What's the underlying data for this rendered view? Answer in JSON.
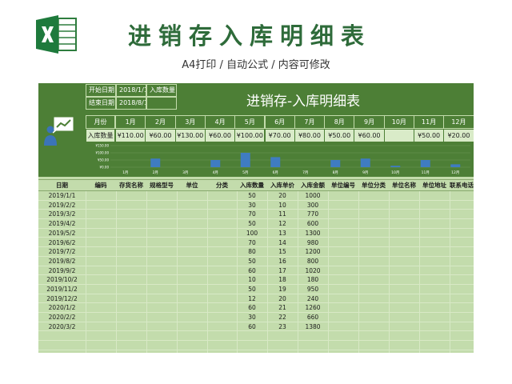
{
  "header": {
    "title": "进销存入库明细表",
    "subtitle": "A4打印 / 自动公式 / 内容可修改"
  },
  "sheet": {
    "title": "进销存-入库明细表",
    "info": {
      "start_label": "开始日期",
      "start_value": "2018/1/1",
      "end_label": "结束日期",
      "end_value": "2018/8/1",
      "qty_label": "入库数量"
    },
    "month_row_label": "月份",
    "amount_row_label": "入库数量",
    "months": [
      "1月",
      "2月",
      "3月",
      "4月",
      "5月",
      "6月",
      "7月",
      "8月",
      "9月",
      "10月",
      "11月",
      "12月"
    ],
    "amounts": [
      "¥110.00",
      "¥60.00",
      "¥130.00",
      "¥60.00",
      "¥100.00",
      "¥70.00",
      "¥80.00",
      "¥50.00",
      "¥60.00",
      "",
      "¥50.00",
      "¥20.00"
    ]
  },
  "chart_data": {
    "type": "bar",
    "categories": [
      "1月",
      "2月",
      "3月",
      "4月",
      "5月",
      "6月",
      "7月",
      "8月",
      "9月",
      "10月",
      "11月",
      "12月"
    ],
    "values": [
      0,
      60,
      0,
      50,
      100,
      70,
      0,
      50,
      60,
      10,
      50,
      20
    ],
    "ytick_labels": [
      "¥150.00",
      "¥100.00",
      "¥50.00",
      "¥0.00"
    ],
    "yticks": [
      150,
      100,
      50,
      0
    ],
    "ylim": [
      0,
      150
    ],
    "bar_color": "#3f7cc1"
  },
  "table": {
    "columns": [
      "日期",
      "编码",
      "存货名称",
      "规格型号",
      "单位",
      "分类",
      "入库数量",
      "入库单价",
      "入库金额",
      "单位编号",
      "单位分类",
      "单位名称",
      "单位地址",
      "联系电话"
    ],
    "rows": [
      {
        "date": "2019/1/1",
        "qty": "50",
        "price": "20",
        "amount": "1000"
      },
      {
        "date": "2019/2/2",
        "qty": "30",
        "price": "10",
        "amount": "300"
      },
      {
        "date": "2019/3/2",
        "qty": "70",
        "price": "11",
        "amount": "770"
      },
      {
        "date": "2019/4/2",
        "qty": "50",
        "price": "12",
        "amount": "600"
      },
      {
        "date": "2019/5/2",
        "qty": "100",
        "price": "13",
        "amount": "1300"
      },
      {
        "date": "2019/6/2",
        "qty": "70",
        "price": "14",
        "amount": "980"
      },
      {
        "date": "2019/7/2",
        "qty": "80",
        "price": "15",
        "amount": "1200"
      },
      {
        "date": "2019/8/2",
        "qty": "50",
        "price": "16",
        "amount": "800"
      },
      {
        "date": "2019/9/2",
        "qty": "60",
        "price": "17",
        "amount": "1020"
      },
      {
        "date": "2019/10/2",
        "qty": "10",
        "price": "18",
        "amount": "180"
      },
      {
        "date": "2019/11/2",
        "qty": "50",
        "price": "19",
        "amount": "950"
      },
      {
        "date": "2019/12/2",
        "qty": "12",
        "price": "20",
        "amount": "240"
      },
      {
        "date": "2020/1/2",
        "qty": "60",
        "price": "21",
        "amount": "1260"
      },
      {
        "date": "2020/2/2",
        "qty": "30",
        "price": "22",
        "amount": "660"
      },
      {
        "date": "2020/3/2",
        "qty": "60",
        "price": "23",
        "amount": "1380"
      }
    ]
  }
}
